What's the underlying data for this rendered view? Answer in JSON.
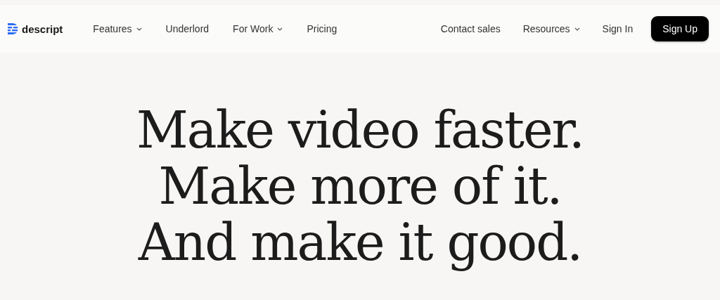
{
  "logo": {
    "text": "descript"
  },
  "nav_left": [
    {
      "label": "Features",
      "dropdown": true
    },
    {
      "label": "Underlord",
      "dropdown": false
    },
    {
      "label": "For Work",
      "dropdown": true
    },
    {
      "label": "Pricing",
      "dropdown": false
    }
  ],
  "nav_right": [
    {
      "label": "Contact sales",
      "dropdown": false
    },
    {
      "label": "Resources",
      "dropdown": true
    },
    {
      "label": "Sign In",
      "dropdown": false
    }
  ],
  "cta_button": "Sign Up",
  "headline": [
    "Make video faster.",
    "Make more of it.",
    "And make it good."
  ]
}
